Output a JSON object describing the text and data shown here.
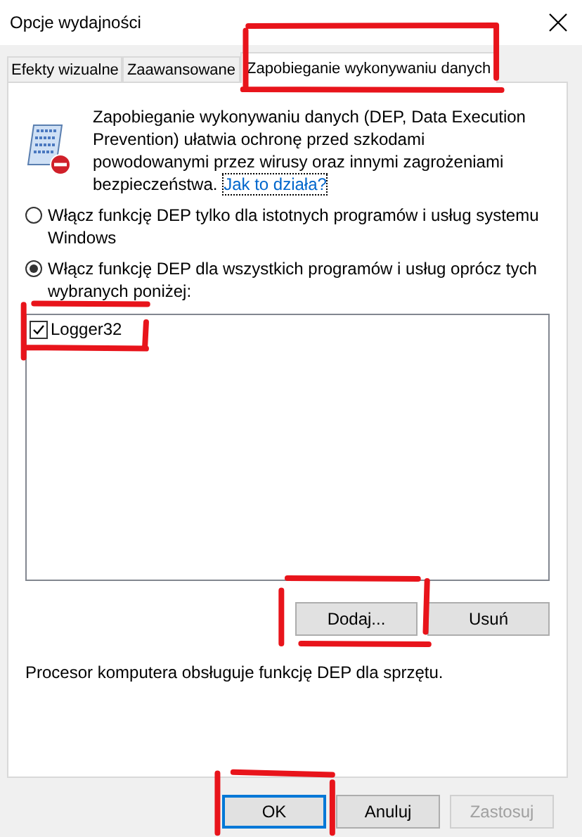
{
  "window": {
    "title": "Opcje wydajności"
  },
  "tabs": [
    {
      "label": "Efekty wizualne",
      "selected": false,
      "highlighted": false
    },
    {
      "label": "Zaawansowane",
      "selected": false,
      "highlighted": false
    },
    {
      "label": "Zapobieganie wykonywaniu danych",
      "selected": true,
      "highlighted": true
    }
  ],
  "intro": {
    "text": "Zapobieganie wykonywaniu danych (DEP, Data Execution Prevention) ułatwia ochronę przed szkodami powodowanymi przez wirusy oraz innymi zagrożeniami bezpieczeństwa.",
    "link": "Jak to działa?"
  },
  "options": [
    {
      "label": "Włącz funkcję DEP tylko dla istotnych programów i usług systemu Windows",
      "selected": false
    },
    {
      "label": "Włącz funkcję DEP dla wszystkich programów i usług oprócz tych wybranych poniżej:",
      "selected": true
    }
  ],
  "programs": [
    {
      "name": "Logger32",
      "checked": true,
      "highlighted": true
    }
  ],
  "list_buttons": [
    {
      "label": "Dodaj...",
      "highlighted": true,
      "disabled": false
    },
    {
      "label": "Usuń",
      "highlighted": false,
      "disabled": false
    }
  ],
  "status": "Procesor komputera obsługuje funkcję DEP dla sprzętu.",
  "buttons": [
    {
      "label": "OK",
      "default": true,
      "highlighted": true,
      "disabled": false
    },
    {
      "label": "Anuluj",
      "default": false,
      "highlighted": false,
      "disabled": false
    },
    {
      "label": "Zastosuj",
      "default": false,
      "highlighted": false,
      "disabled": true
    }
  ]
}
